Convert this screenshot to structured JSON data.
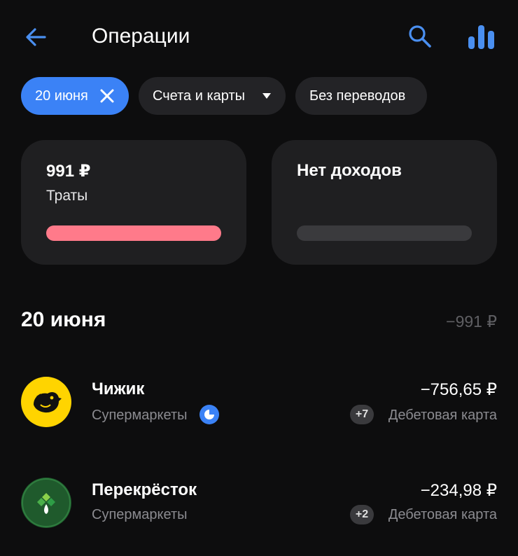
{
  "header": {
    "title": "Операции"
  },
  "filters": {
    "date_chip": "20 июня",
    "accounts_chip": "Счета и карты",
    "transfers_chip": "Без переводов"
  },
  "summary": {
    "spend_amount": "991 ₽",
    "spend_label": "Траты",
    "spend_fill": 1.0,
    "income_label": "Нет доходов",
    "spend_color": "#ff7a8a"
  },
  "section": {
    "date": "20 июня",
    "total": "−991 ₽"
  },
  "operations": [
    {
      "merchant": "Чижик",
      "category": "Супермаркеты",
      "amount": "−756,65 ₽",
      "badge": "+7",
      "card": "Дебетовая карта",
      "logo_color": "#ffd400",
      "logo_icon": "bird-icon"
    },
    {
      "merchant": "Перекрёсток",
      "category": "Супермаркеты",
      "amount": "−234,98 ₽",
      "badge": "+2",
      "card": "Дебетовая карта",
      "logo_color": "#1f5a2c",
      "logo_icon": "clover-icon"
    }
  ],
  "colors": {
    "accent": "#3b82f6",
    "background": "#0d0d0e",
    "card": "#1f1f21"
  }
}
